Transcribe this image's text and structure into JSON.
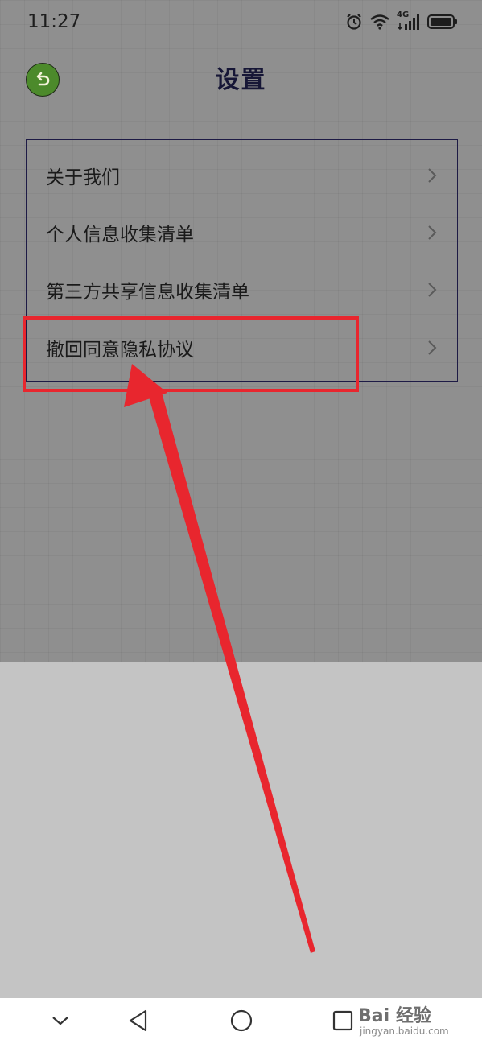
{
  "status_bar": {
    "time": "11:27",
    "network_label": "4G",
    "icons": [
      "alarm-icon",
      "wifi-icon",
      "signal-icon",
      "battery-icon"
    ]
  },
  "header": {
    "title": "设置",
    "back_icon": "back-arrow-icon"
  },
  "menu": {
    "items": [
      {
        "label": "关于我们"
      },
      {
        "label": "个人信息收集清单"
      },
      {
        "label": "第三方共享信息收集清单"
      },
      {
        "label": "撤回同意隐私协议"
      }
    ]
  },
  "annotation": {
    "highlight_color": "#e8262e",
    "arrow_color": "#e8262e"
  },
  "navigation_bar": {
    "buttons": [
      "collapse-icon",
      "back-triangle-icon",
      "home-circle-icon",
      "recents-square-icon"
    ]
  },
  "watermark": {
    "main": "Bai 经验",
    "sub": "jingyan.baidu.com"
  },
  "colors": {
    "back_button": "#4c8a2b",
    "title": "#161636",
    "panel_border": "#1d1a45"
  }
}
